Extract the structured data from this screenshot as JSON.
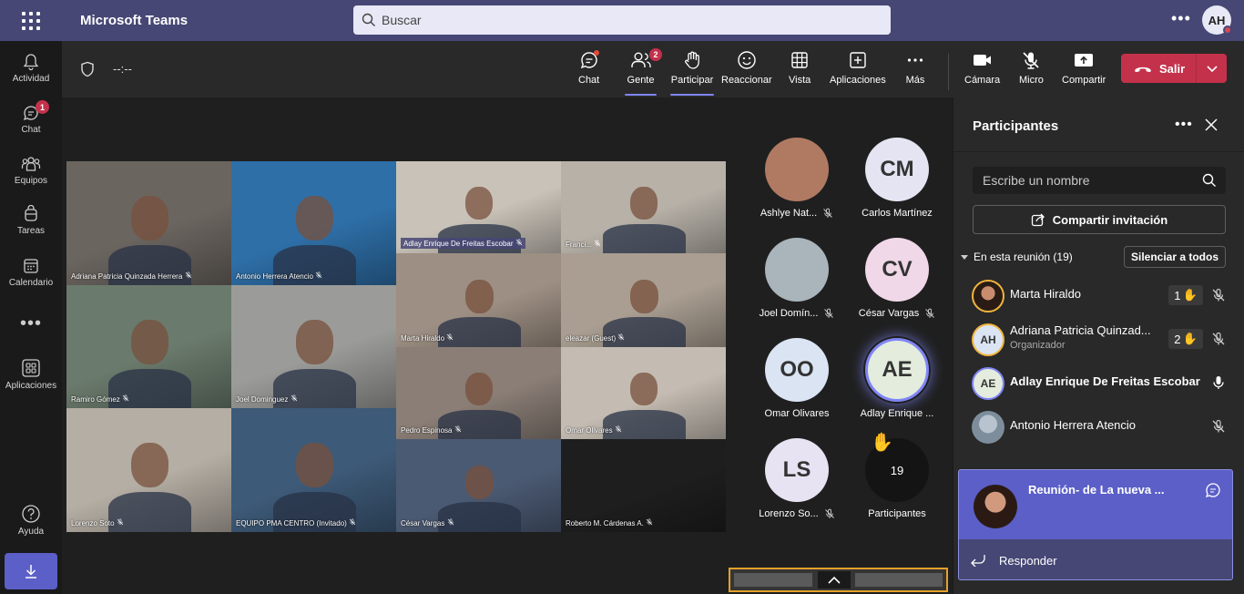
{
  "app": {
    "title": "Microsoft Teams"
  },
  "search": {
    "placeholder": "Buscar"
  },
  "user": {
    "initials": "AH"
  },
  "rail": [
    {
      "label": "Actividad",
      "icon": "bell-icon",
      "badge": ""
    },
    {
      "label": "Chat",
      "icon": "chat-icon",
      "badge": "1"
    },
    {
      "label": "Equipos",
      "icon": "teams-icon",
      "badge": ""
    },
    {
      "label": "Tareas",
      "icon": "tasks-icon",
      "badge": ""
    },
    {
      "label": "Calendario",
      "icon": "calendar-icon",
      "badge": ""
    },
    {
      "label": "Aplicaciones",
      "icon": "apps-icon",
      "badge": ""
    },
    {
      "label": "Ayuda",
      "icon": "help-icon",
      "badge": ""
    }
  ],
  "meeting": {
    "timer": "--:--",
    "tools": [
      {
        "label": "Chat",
        "icon": "chat-icon",
        "badge": ""
      },
      {
        "label": "Gente",
        "icon": "people-icon",
        "badge": "2"
      },
      {
        "label": "Participar",
        "icon": "raise-hand-icon",
        "badge": ""
      },
      {
        "label": "Reaccionar",
        "icon": "smile-icon",
        "badge": ""
      },
      {
        "label": "Vista",
        "icon": "grid-view-icon",
        "badge": ""
      },
      {
        "label": "Aplicaciones",
        "icon": "add-app-icon",
        "badge": ""
      },
      {
        "label": "Más",
        "icon": "more-icon",
        "badge": ""
      },
      {
        "label": "Cámara",
        "icon": "camera-icon",
        "badge": ""
      },
      {
        "label": "Micro",
        "icon": "mic-off-icon",
        "badge": ""
      },
      {
        "label": "Compartir",
        "icon": "share-icon",
        "badge": ""
      }
    ],
    "leave_label": "Salir"
  },
  "video_tiles": [
    {
      "name": "Adriana Patricia Quinzada Herrera",
      "bg": "#6b6560"
    },
    {
      "name": "Antonio Herrera Atencio",
      "bg": "#2e6fa8"
    },
    {
      "name": "Adlay Enrique De Freitas Escobar",
      "bg": "#c9c2b8"
    },
    {
      "name": "Franci...",
      "bg": "#b7b1a8"
    },
    {
      "name": "Marta Hiraldo",
      "bg": "#9d8f83"
    },
    {
      "name": "eleazar (Guest)",
      "bg": "#a99e91"
    },
    {
      "name": "Ramiro Gómez",
      "bg": "#6a7a6c"
    },
    {
      "name": "Joel Dominguez",
      "bg": "#9b9c99"
    },
    {
      "name": "Pedro Espinosa",
      "bg": "#8a7e76"
    },
    {
      "name": "Omar Olivares",
      "bg": "#c4bcb2"
    },
    {
      "name": "Lorenzo Soto",
      "bg": "#b5aea4"
    },
    {
      "name": "EQUIPO PMA CENTRO (Invitado)",
      "bg": "#3d5a78"
    },
    {
      "name": "César Vargas",
      "bg": "#4b5a73"
    },
    {
      "name": "Roberto M. Cárdenas A.",
      "bg": "#1e1e1e"
    }
  ],
  "gallery": [
    {
      "name": "Ashlye Nat...",
      "initials": "",
      "bg": "#b07a62",
      "muted": true,
      "speaking": false
    },
    {
      "name": "Carlos Martínez",
      "initials": "CM",
      "bg": "#e4e4f2",
      "muted": false,
      "speaking": false
    },
    {
      "name": "Joel Domín...",
      "initials": "",
      "bg": "#a9b4bb",
      "muted": true,
      "speaking": false
    },
    {
      "name": "César Vargas",
      "initials": "CV",
      "bg": "#f0d8e8",
      "muted": true,
      "speaking": false
    },
    {
      "name": "Omar Olivares",
      "initials": "OO",
      "bg": "#dbe4f3",
      "muted": false,
      "speaking": false
    },
    {
      "name": "Adlay Enrique ...",
      "initials": "AE",
      "bg": "#e3ecdd",
      "muted": false,
      "speaking": true
    },
    {
      "name": "Lorenzo So...",
      "initials": "LS",
      "bg": "#e7e3f2",
      "muted": true,
      "speaking": false
    },
    {
      "name": "Participantes",
      "initials": "19",
      "bg": "#141414",
      "muted": false,
      "speaking": false
    }
  ],
  "panel": {
    "title": "Participantes",
    "search_placeholder": "Escribe un nombre",
    "invite_label": "Compartir invitación",
    "section_label": "En esta reunión (19)",
    "mute_all_label": "Silenciar a todos",
    "people": [
      {
        "name": "Marta Hiraldo",
        "role": "",
        "initials": "",
        "hand": "1",
        "mic": "muted"
      },
      {
        "name": "Adriana Patricia Quinzad...",
        "role": "Organizador",
        "initials": "AH",
        "hand": "2",
        "mic": "muted"
      },
      {
        "name": "Adlay Enrique De Freitas Escobar",
        "role": "",
        "initials": "AE",
        "hand": "",
        "mic": "on"
      },
      {
        "name": "Antonio Herrera Atencio",
        "role": "",
        "initials": "",
        "hand": "",
        "mic": "muted"
      }
    ]
  },
  "toast": {
    "title": "Reunión- de La nueva ...",
    "reply_label": "Responder"
  },
  "colors": {
    "accent": "#5b5fc7",
    "titlebar": "#464775",
    "danger": "#c4314b",
    "hand": "#f0b53c"
  }
}
